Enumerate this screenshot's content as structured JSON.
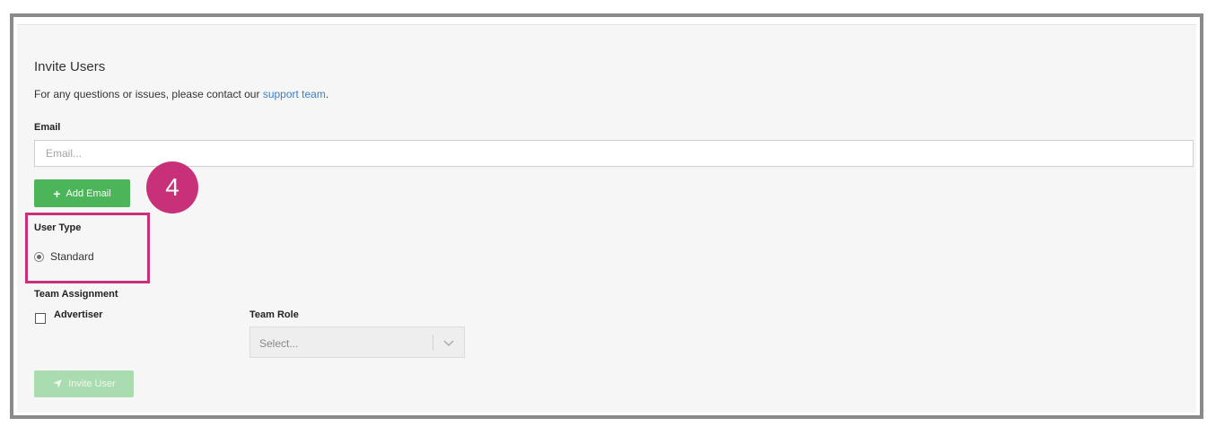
{
  "form": {
    "title": "Invite Users",
    "intro_text": "For any questions or issues, please contact our ",
    "support_link": "support team",
    "intro_end": ".",
    "email_label": "Email",
    "email_placeholder": "Email...",
    "email_value": "",
    "add_email_label": "Add Email",
    "user_type_label": "User Type",
    "user_type_option": "Standard",
    "user_type_selected": true,
    "team_assignment_label": "Team Assignment",
    "team_name": "Advertiser",
    "team_checked": false,
    "team_role_label": "Team Role",
    "team_role_placeholder": "Select...",
    "invite_label": "Invite User",
    "invite_disabled": true
  },
  "callout": {
    "step_number": "4",
    "color": "#c8307a"
  },
  "colors": {
    "primary_button": "#4cb559",
    "disabled_button": "#a9dcae",
    "link": "#3d7fc0"
  },
  "icons": {
    "add": "plus-icon",
    "invite": "send-icon",
    "select": "chevron-down-icon"
  }
}
